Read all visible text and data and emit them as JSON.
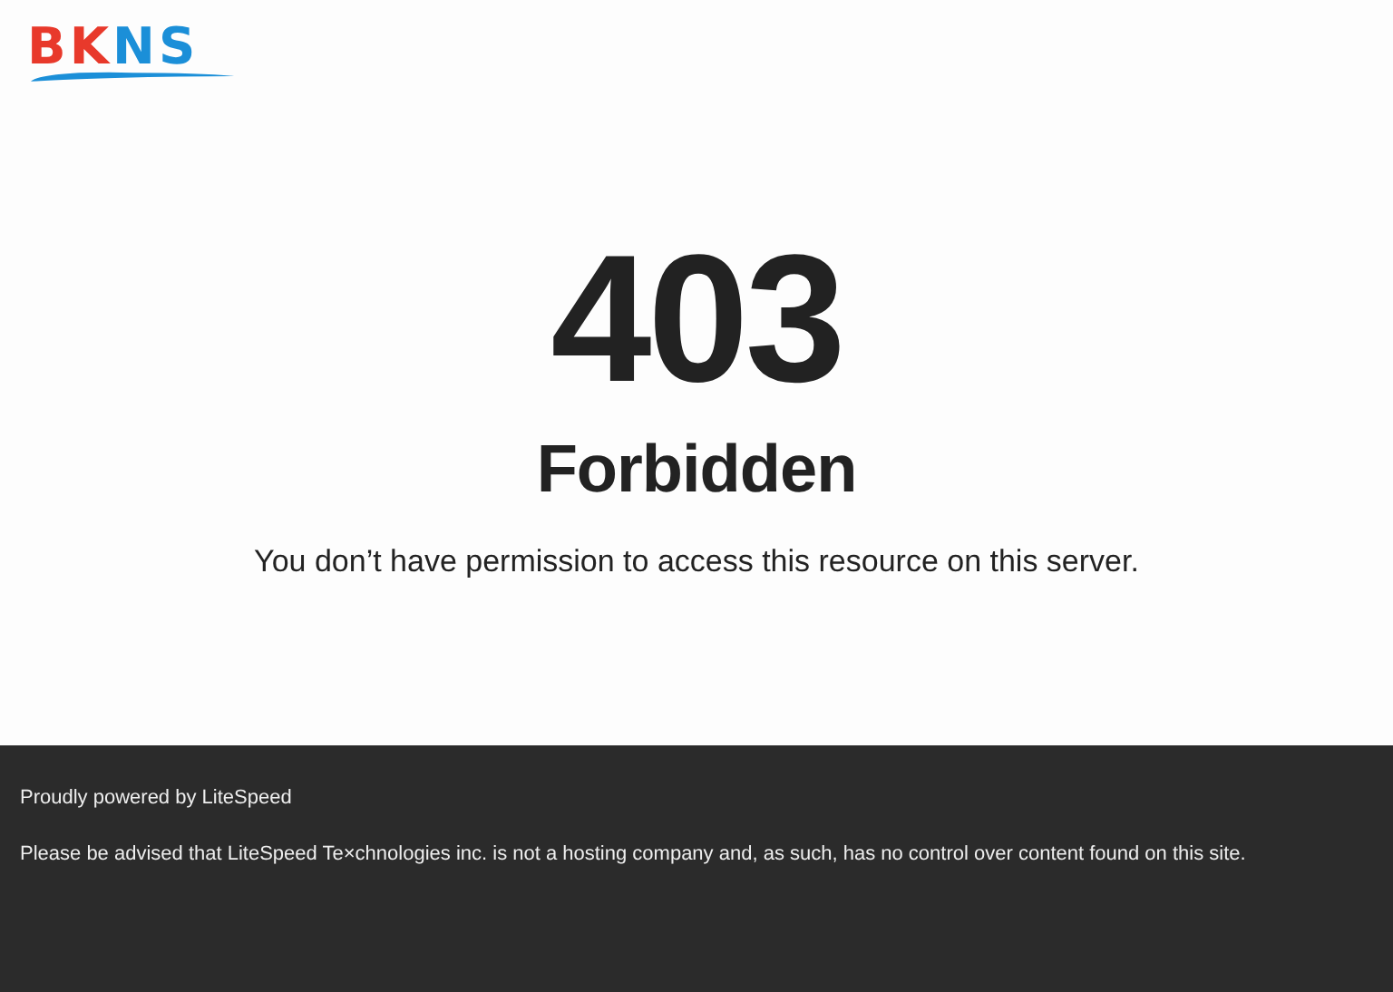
{
  "logo": {
    "parts": [
      {
        "text": "BK",
        "color": "#e8392b"
      },
      {
        "text": "NS",
        "color": "#1b8fd8"
      }
    ]
  },
  "error": {
    "code": "403",
    "title": "Forbidden",
    "message": "You don’t have permission to access this resource on this server."
  },
  "footer": {
    "powered_by": "Proudly powered by",
    "link": "LiteSpeed",
    "notice": "Please be advised that LiteSpeed Te×chnologies inc. is not a hosting company and, as such, has no control over content found on this site."
  }
}
